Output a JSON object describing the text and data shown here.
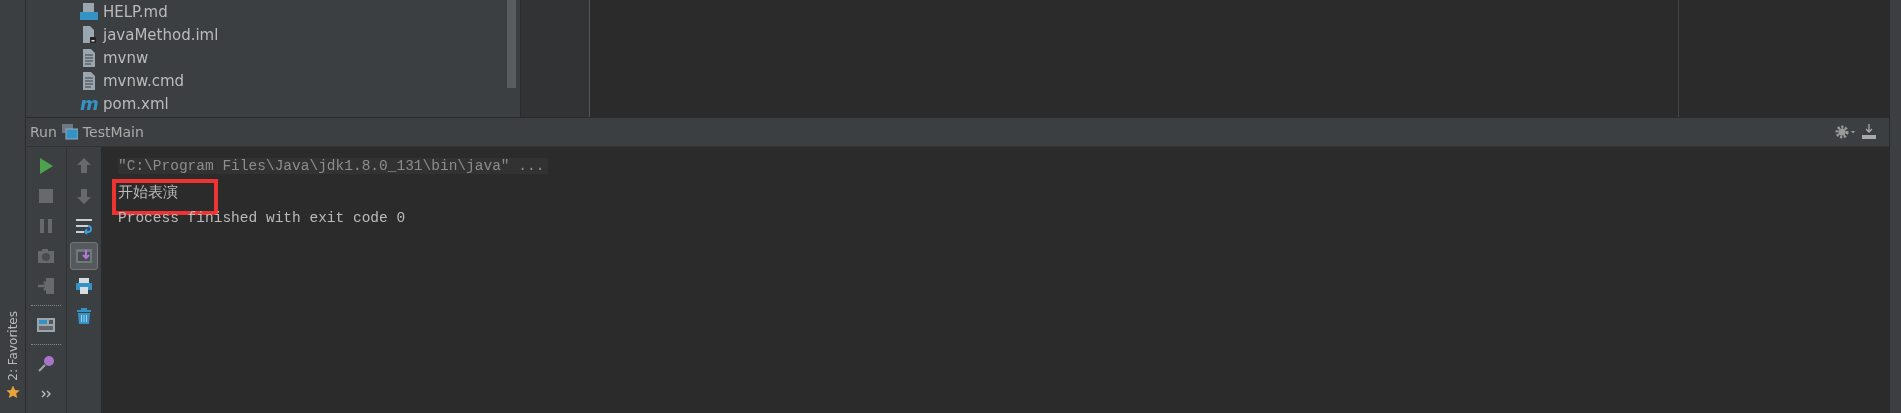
{
  "project_tree": {
    "items": [
      {
        "name": "HELP.md",
        "kind": "markdown"
      },
      {
        "name": "javaMethod.iml",
        "kind": "module"
      },
      {
        "name": "mvnw",
        "kind": "text"
      },
      {
        "name": "mvnw.cmd",
        "kind": "text"
      },
      {
        "name": "pom.xml",
        "kind": "maven",
        "icon": "m"
      }
    ]
  },
  "favorites_tab": {
    "label": "2: Favorites"
  },
  "run_panel": {
    "title": "Run",
    "config": "TestMain",
    "main_toolbar": [
      {
        "kind": "run",
        "disabled": false
      },
      {
        "kind": "stop",
        "disabled": true
      },
      {
        "kind": "pause",
        "disabled": true
      },
      {
        "kind": "camera",
        "disabled": true
      },
      {
        "kind": "exit",
        "disabled": true
      },
      {
        "kind": "separator"
      },
      {
        "kind": "layout",
        "disabled": false
      },
      {
        "kind": "separator"
      },
      {
        "kind": "pin",
        "disabled": false
      },
      {
        "kind": "more",
        "disabled": false
      }
    ],
    "side_toolbar": [
      {
        "kind": "up",
        "disabled": true,
        "on": false
      },
      {
        "kind": "down",
        "disabled": true,
        "on": false
      },
      {
        "kind": "wrap",
        "disabled": false,
        "on": false
      },
      {
        "kind": "scroll-end",
        "disabled": false,
        "on": true
      },
      {
        "kind": "print",
        "disabled": false,
        "on": false
      },
      {
        "kind": "trash",
        "disabled": false,
        "on": false
      }
    ],
    "console": {
      "lines": [
        {
          "kind": "command",
          "text": "\"C:\\Program Files\\Java\\jdk1.8.0_131\\bin\\java\" ...",
          "highlighted": false
        },
        {
          "kind": "output",
          "text": "开始表演",
          "highlighted": true
        },
        {
          "kind": "output",
          "text": "Process finished with exit code 0",
          "highlighted": false
        }
      ]
    }
  }
}
